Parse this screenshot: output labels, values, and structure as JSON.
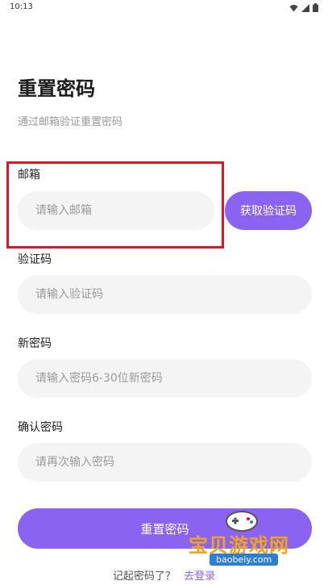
{
  "status_bar": {
    "time": "10:13"
  },
  "page": {
    "title": "重置密码",
    "subtitle": "通过邮箱验证重置密码"
  },
  "form": {
    "email": {
      "label": "邮箱",
      "placeholder": "请输入邮箱",
      "value": ""
    },
    "get_code_button": "获取验证码",
    "code": {
      "label": "验证码",
      "placeholder": "请输入验证码",
      "value": ""
    },
    "new_password": {
      "label": "新密码",
      "placeholder": "请输入密码6-30位新密码",
      "value": ""
    },
    "confirm_password": {
      "label": "确认密码",
      "placeholder": "请再次输入密码",
      "value": ""
    },
    "submit_button": "重置密码"
  },
  "footer": {
    "prompt": "记起密码了？",
    "login_link": "去登录"
  },
  "watermark": {
    "text": "宝贝游戏网",
    "url": "baobeiy.com"
  },
  "colors": {
    "accent": "#8a63f0",
    "highlight": "#e0142c",
    "input_bg": "#f4f4f4"
  },
  "icons": [
    "wifi-icon",
    "signal-icon",
    "battery-icon"
  ]
}
